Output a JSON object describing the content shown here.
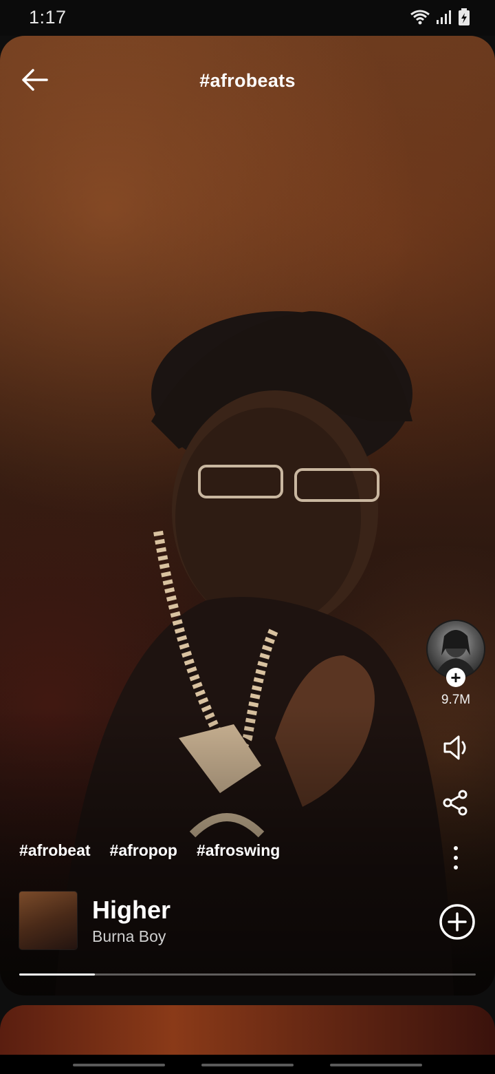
{
  "status_bar": {
    "time": "1:17",
    "icons": [
      "wifi-icon",
      "signal-icon",
      "battery-charging-icon"
    ]
  },
  "header": {
    "back_icon": "arrow-left-icon",
    "title": "#afrobeats"
  },
  "side_actions": {
    "follow_count": "9.7M",
    "follow_icon": "plus-icon",
    "sound_icon": "speaker-icon",
    "share_icon": "share-icon",
    "more_icon": "more-vertical-icon"
  },
  "hashtags": [
    "#afrobeat",
    "#afropop",
    "#afroswing"
  ],
  "track": {
    "title": "Higher",
    "artist": "Burna Boy",
    "add_icon": "plus-circle-icon"
  },
  "playback": {
    "progress_fraction": 0.165
  },
  "colors": {
    "background": "#0e0e0e",
    "card_tint": "#6a3a1e",
    "text": "#ffffff",
    "muted": "#cfcfcf"
  }
}
